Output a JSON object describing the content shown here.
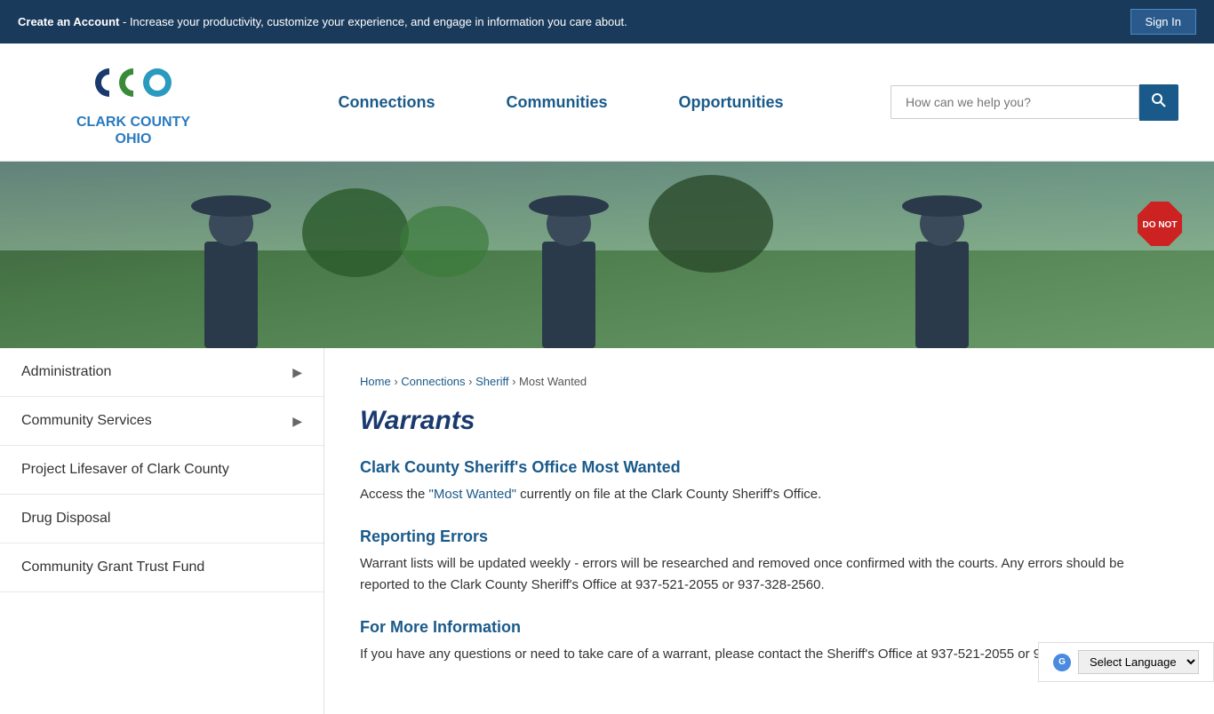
{
  "topBanner": {
    "createText": "Create an Account",
    "bannerMessage": " - Increase your productivity, customize your experience, and engage in information you care about.",
    "signInLabel": "Sign In"
  },
  "header": {
    "logoLine1": "CLARK COUNTY",
    "logoLine2": "OHIO",
    "searchPlaceholder": "How can we help you?",
    "nav": [
      {
        "label": "Connections",
        "id": "connections"
      },
      {
        "label": "Communities",
        "id": "communities"
      },
      {
        "label": "Opportunities",
        "id": "opportunities"
      }
    ]
  },
  "sidebar": {
    "items": [
      {
        "label": "Administration",
        "hasArrow": true,
        "id": "administration"
      },
      {
        "label": "Community Services",
        "hasArrow": true,
        "id": "community-services"
      },
      {
        "label": "Project Lifesaver of Clark County",
        "hasArrow": false,
        "id": "project-lifesaver"
      },
      {
        "label": "Drug Disposal",
        "hasArrow": false,
        "id": "drug-disposal"
      },
      {
        "label": "Community Grant Trust Fund",
        "hasArrow": false,
        "id": "community-grant"
      }
    ]
  },
  "breadcrumb": {
    "items": [
      {
        "label": "Home",
        "href": "#"
      },
      {
        "label": "Connections",
        "href": "#"
      },
      {
        "label": "Sheriff",
        "href": "#"
      },
      {
        "label": "Most Wanted",
        "href": null
      }
    ],
    "separator": "›"
  },
  "content": {
    "pageTitle": "Warrants",
    "sections": [
      {
        "id": "most-wanted",
        "heading": "Clark County Sheriff's Office Most Wanted",
        "text": "Access the ",
        "linkText": "\"Most Wanted\"",
        "textAfter": " currently on file at the Clark County Sheriff's Office."
      },
      {
        "id": "reporting-errors",
        "heading": "Reporting Errors",
        "text": "Warrant lists will be updated weekly - errors will be researched and removed once confirmed with the courts. Any errors should be reported to the Clark County Sheriff's Office at 937-521-2055 or 937-328-2560."
      },
      {
        "id": "more-info",
        "heading": "For More Information",
        "text": "If you have any questions or need to take care of a warrant, please contact the Sheriff's Office at 937-521-2055 or 937-328-2560."
      }
    ]
  },
  "languageBar": {
    "label": "Select Language",
    "icon": "G"
  }
}
